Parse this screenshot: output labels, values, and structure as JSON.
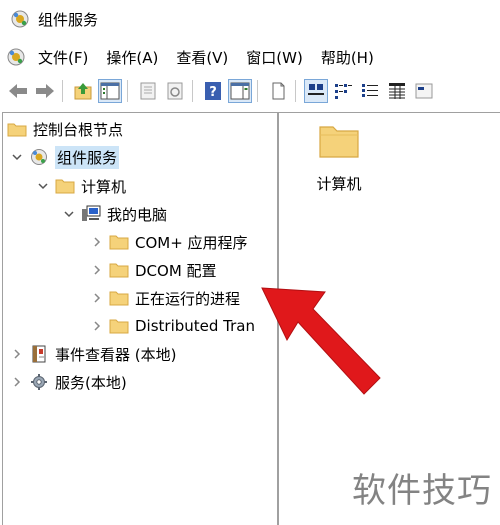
{
  "window": {
    "title": "组件服务"
  },
  "menu": [
    "文件(F)",
    "操作(A)",
    "查看(V)",
    "窗口(W)",
    "帮助(H)"
  ],
  "tree": {
    "root": "控制台根节点",
    "component_services": "组件服务",
    "computers": "计算机",
    "my_computer": "我的电脑",
    "com_apps": "COM+ 应用程序",
    "dcom_config": "DCOM 配置",
    "running_processes": "正在运行的进程",
    "distributed": "Distributed Tran",
    "event_viewer": "事件查看器 (本地)",
    "services": "服务(本地)"
  },
  "right_pane": {
    "items": [
      "计算机"
    ]
  },
  "watermark": "软件技巧",
  "colors": {
    "folder": "#f5d27a",
    "folder_edge": "#d8a843",
    "selection": "#cce4f7",
    "arrow": "#e0181b"
  },
  "icons": [
    "app-icon",
    "back-icon",
    "forward-icon",
    "up-icon",
    "show-tree-icon",
    "properties-icon",
    "refresh-icon",
    "help-icon",
    "show-action-pane-icon",
    "new-icon",
    "large-icons-view-icon",
    "small-icons-view-icon",
    "list-view-icon",
    "details-view-icon",
    "more-icon"
  ]
}
